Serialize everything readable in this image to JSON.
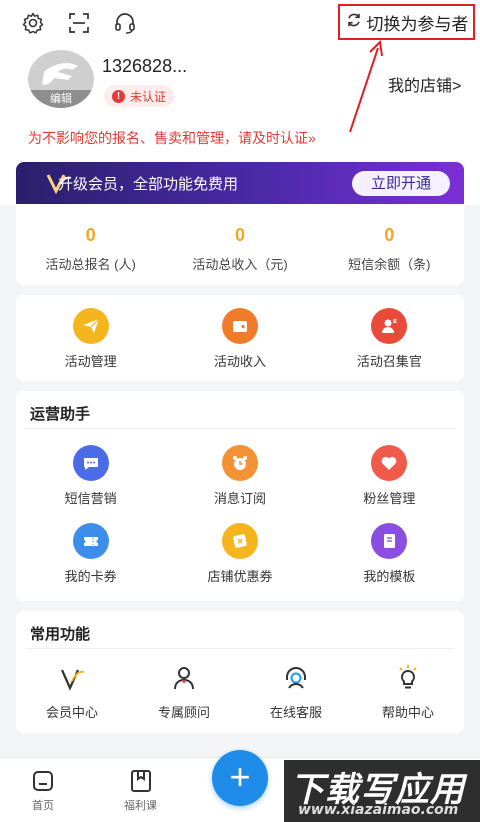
{
  "header": {
    "settings_icon": "gear-icon",
    "scan_icon": "scan-icon",
    "service_icon": "headset-icon",
    "switch_label": "切换为参与者"
  },
  "profile": {
    "avatar_edit": "编辑",
    "phone": "1326828...",
    "auth_status": "未认证",
    "auth_mark": "!",
    "my_store": "我的店铺>",
    "notice": "为不影响您的报名、售卖和管理，请及时认证»"
  },
  "vip": {
    "text": "升级会员，全部功能免费用",
    "button": "立即开通"
  },
  "stats": [
    {
      "value": "0",
      "label": "活动总报名 (人)"
    },
    {
      "value": "0",
      "label": "活动总收入（元)"
    },
    {
      "value": "0",
      "label": "短信余额（条)"
    }
  ],
  "quick": [
    {
      "label": "活动管理",
      "icon": "paper-plane-icon",
      "color": "#f5b51d"
    },
    {
      "label": "活动收入",
      "icon": "wallet-icon",
      "color": "#f07b2a"
    },
    {
      "label": "活动召集官",
      "icon": "person-flag-icon",
      "color": "#ea4a3a"
    }
  ],
  "operations": {
    "title": "运营助手",
    "items": [
      {
        "label": "短信营销",
        "icon": "chat-bubble-icon",
        "color": "#4a6ce8"
      },
      {
        "label": "消息订阅",
        "icon": "clock-icon",
        "color": "#f39234"
      },
      {
        "label": "粉丝管理",
        "icon": "heart-icon",
        "color": "#ef5a4a"
      },
      {
        "label": "我的卡券",
        "icon": "ticket-icon",
        "color": "#3d8ee8"
      },
      {
        "label": "店铺优惠券",
        "icon": "coupon-icon",
        "color": "#f5b51d"
      },
      {
        "label": "我的模板",
        "icon": "book-icon",
        "color": "#8a4ee0"
      }
    ]
  },
  "common": {
    "title": "常用功能",
    "items": [
      {
        "label": "会员中心",
        "icon": "vip-v-icon"
      },
      {
        "label": "专属顾问",
        "icon": "person-icon"
      },
      {
        "label": "在线客服",
        "icon": "headset-icon"
      },
      {
        "label": "帮助中心",
        "icon": "lightbulb-icon"
      }
    ]
  },
  "tabbar": {
    "home": "首页",
    "welfare": "福利课",
    "fab": "+"
  },
  "watermark": {
    "big": "下载写应用",
    "small": "www.xiazaimao.com"
  }
}
